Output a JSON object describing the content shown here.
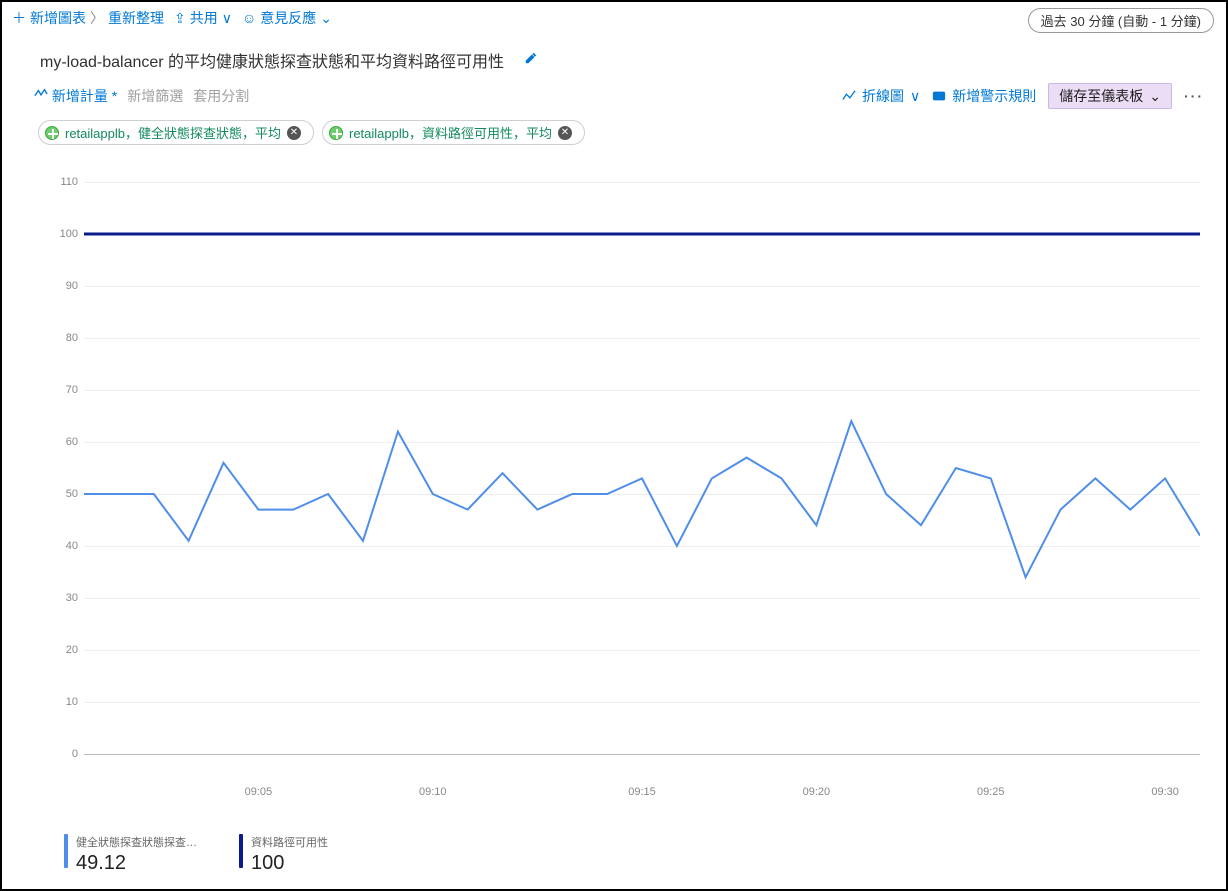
{
  "topbar": {
    "add_chart": "新增圖表",
    "refresh": "重新整理",
    "share": "共用",
    "feedback": "意見反應",
    "time_range": "過去 30 分鐘 (自動 -  1 分鐘)"
  },
  "title": "my-load-balancer 的平均健康狀態探查狀態和平均資料路徑可用性",
  "toolbar2": {
    "add_metric": "新增計量 *",
    "add_filter": "新增篩選",
    "apply_split": "套用分割",
    "chart_type": "折線圖",
    "new_alert": "新增警示規則",
    "save_dash": "儲存至儀表板"
  },
  "pills": [
    {
      "text": "retailapplb，健全狀態探查狀態，平均"
    },
    {
      "text": "retailapplb，資料路徑可用性，平均"
    }
  ],
  "legend": [
    {
      "name": "健全狀態探查狀態探查…",
      "value": "49.12",
      "color": "#4f8ee8"
    },
    {
      "name": "資料路徑可用性",
      "value": "100",
      "color": "#0b1b8c"
    }
  ],
  "chart_data": {
    "type": "line",
    "xlabel": "",
    "ylabel": "",
    "ylim": [
      0,
      110
    ],
    "y_ticks": [
      0,
      10,
      20,
      30,
      40,
      50,
      60,
      70,
      80,
      90,
      100,
      110
    ],
    "x_tick_labels": [
      "09:05",
      "09:10",
      "09:15",
      "09:20",
      "09:25",
      "09:30"
    ],
    "x": [
      0,
      1,
      2,
      3,
      4,
      5,
      6,
      7,
      8,
      9,
      10,
      11,
      12,
      13,
      14,
      15,
      16,
      17,
      18,
      19,
      20,
      21,
      22,
      23,
      24,
      25,
      26,
      27,
      28,
      29,
      30,
      31
    ],
    "series": [
      {
        "name": "健全狀態探查狀態",
        "color": "#4f8ee8",
        "stroke": 2,
        "values": [
          50,
          50,
          50,
          41,
          56,
          47,
          47,
          50,
          41,
          62,
          50,
          47,
          54,
          47,
          50,
          50,
          53,
          40,
          53,
          57,
          53,
          44,
          64,
          50,
          44,
          55,
          53,
          34,
          47,
          53,
          47,
          53,
          42
        ]
      },
      {
        "name": "資料路徑可用性",
        "color": "#0b1b8c",
        "stroke": 3,
        "values": [
          100,
          100,
          100,
          100,
          100,
          100,
          100,
          100,
          100,
          100,
          100,
          100,
          100,
          100,
          100,
          100,
          100,
          100,
          100,
          100,
          100,
          100,
          100,
          100,
          100,
          100,
          100,
          100,
          100,
          100,
          100,
          100,
          100
        ]
      }
    ]
  }
}
